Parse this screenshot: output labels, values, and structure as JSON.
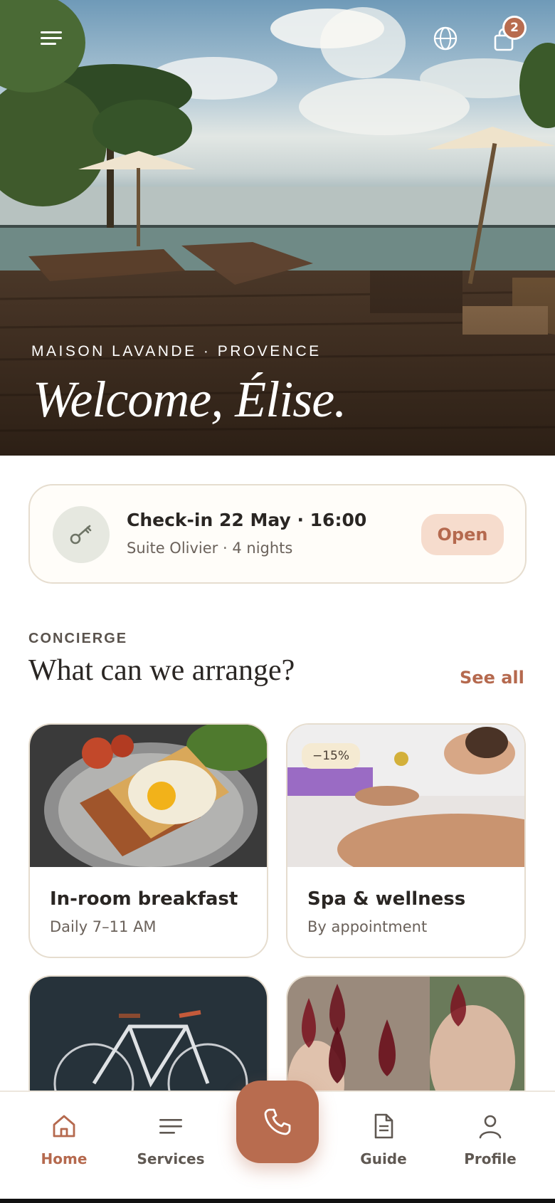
{
  "hero": {
    "eyebrow": "MAISON LAVANDE · PROVENCE",
    "welcome": "Welcome,  Élise.",
    "cart_count": "2"
  },
  "icons": {
    "menu": "menu-icon",
    "globe": "globe-icon",
    "bag": "bag-icon",
    "key": "key-icon",
    "phone": "phone-icon",
    "home": "home-icon",
    "services": "services-icon",
    "guide": "document-icon",
    "profile": "user-icon"
  },
  "checkin": {
    "title": "Check-in 22 May · 16:00",
    "subtitle": "Suite Olivier · 4 nights",
    "action": "Open"
  },
  "concierge": {
    "eyebrow": "CONCIERGE",
    "title": "What can we arrange?",
    "see_all": "See all",
    "cards": [
      {
        "title": "In-room breakfast",
        "subtitle": "Daily 7–11 AM",
        "badge": ""
      },
      {
        "title": "Spa & wellness",
        "subtitle": "By appointment",
        "badge": "−15%"
      },
      {
        "title": "",
        "subtitle": "",
        "badge": ""
      },
      {
        "title": "",
        "subtitle": "",
        "badge": ""
      }
    ]
  },
  "nav": {
    "home": "Home",
    "services": "Services",
    "guide": "Guide",
    "profile": "Profile"
  },
  "colors": {
    "accent": "#b86c4f",
    "accent_soft": "#f6dccd",
    "border": "#e6ddcf",
    "text": "#2a2623",
    "muted": "#6b625b"
  }
}
